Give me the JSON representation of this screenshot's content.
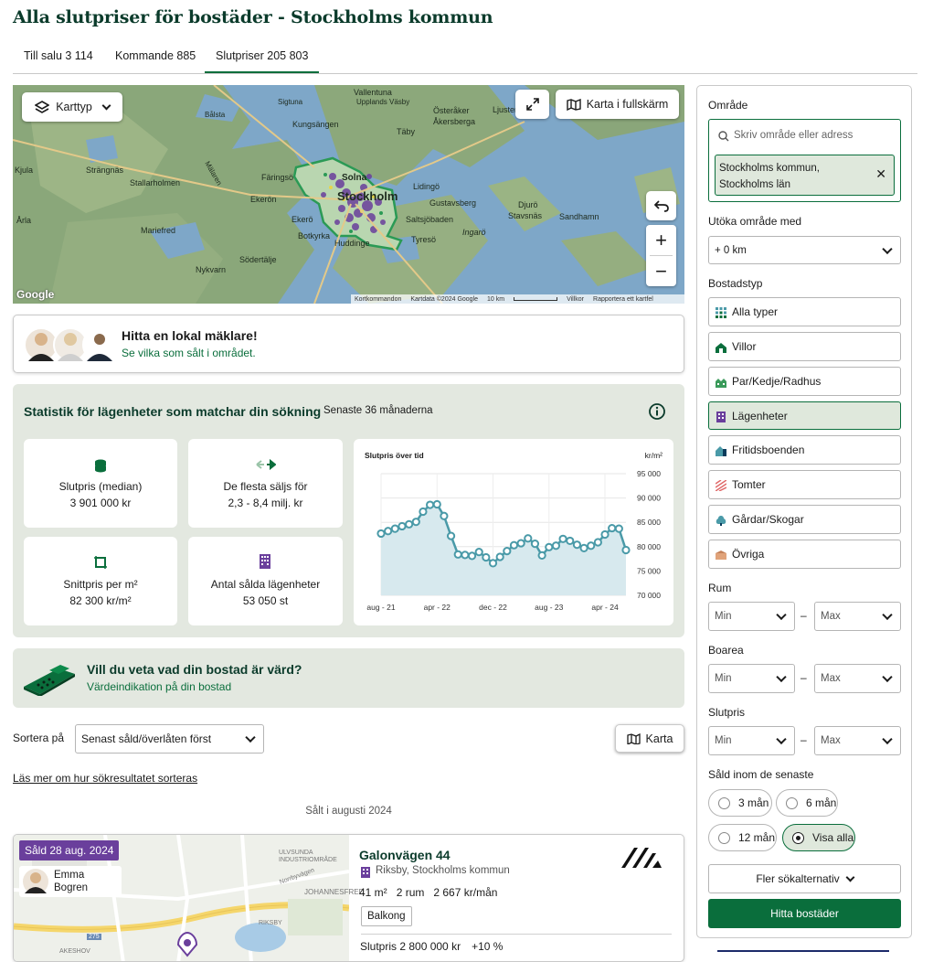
{
  "page": {
    "title": "Alla slutpriser för bostäder - Stockholms kommun"
  },
  "tabs": [
    {
      "label": "Till salu 3 114",
      "active": false
    },
    {
      "label": "Kommande 885",
      "active": false
    },
    {
      "label": "Slutpriser 205 803",
      "active": true
    }
  ],
  "map": {
    "map_type_label": "Karttyp",
    "fullscreen_label": "Karta i fullskärm",
    "places": [
      "Vallentuna",
      "Upplands Väsby",
      "Sigtuna",
      "Österåker",
      "Kungsängen",
      "Åkersberga",
      "Ljusterö",
      "Bålsta",
      "Täby",
      "Kjula",
      "Strängnäs",
      "Stallarholmen",
      "Färingsö",
      "Mälaren",
      "Solna",
      "Stockholm",
      "Lidingö",
      "Gustavsberg",
      "Djurö",
      "Stavsnäs",
      "Sandhamn",
      "Ekerön",
      "Ekerö",
      "Saltsjöbaden",
      "Ingarö",
      "Årla",
      "Mariefred",
      "Botkyrka",
      "Huddinge",
      "Tyresö",
      "Nykvarn",
      "Södertälje",
      "Google"
    ],
    "footer": [
      "Kortkommandon",
      "Kartdata ©2024 Google",
      "10 km",
      "Villkor",
      "Rapportera ett kartfel"
    ]
  },
  "agent_promo": {
    "title": "Hitta en lokal mäklare!",
    "subtitle": "Se vilka som sålt i området."
  },
  "stats": {
    "heading": "Statistik för lägenheter som matchar din sökning",
    "period": "Senaste 36 månaderna",
    "cards": [
      {
        "icon": "coins-icon",
        "label": "Slutpris (median)",
        "value": "3 901 000 kr"
      },
      {
        "icon": "arrows-icon",
        "label": "De flesta säljs för",
        "value": "2,3 - 8,4 milj. kr"
      },
      {
        "icon": "ruler-icon",
        "label": "Snittpris per m²",
        "value": "82 300 kr/m²"
      },
      {
        "icon": "building-icon",
        "label": "Antal sålda lägenheter",
        "value": "53 050 st"
      }
    ],
    "colors": {
      "line": "#4a9aa8",
      "fill": "#d7e9ee",
      "panel": "#e3e8e0"
    }
  },
  "chart_data": {
    "type": "area",
    "title": "Slutpris över tid",
    "ylabel": "kr/m²",
    "x_tick_labels": [
      "aug - 21",
      "apr - 22",
      "dec - 22",
      "aug - 23",
      "apr - 24"
    ],
    "y_tick_labels": [
      "95 000",
      "90 000",
      "85 000",
      "80 000",
      "75 000",
      "70 000"
    ],
    "ylim": [
      70000,
      95000
    ],
    "grid": true,
    "x": [
      "2021-08",
      "2021-09",
      "2021-10",
      "2021-11",
      "2021-12",
      "2022-01",
      "2022-02",
      "2022-03",
      "2022-04",
      "2022-05",
      "2022-06",
      "2022-07",
      "2022-08",
      "2022-09",
      "2022-10",
      "2022-11",
      "2022-12",
      "2023-01",
      "2023-02",
      "2023-03",
      "2023-04",
      "2023-05",
      "2023-06",
      "2023-07",
      "2023-08",
      "2023-09",
      "2023-10",
      "2023-11",
      "2023-12",
      "2024-01",
      "2024-02",
      "2024-03",
      "2024-04",
      "2024-05",
      "2024-06",
      "2024-07"
    ],
    "values": [
      82700,
      83200,
      83700,
      84200,
      84600,
      85100,
      87200,
      88600,
      88700,
      86300,
      82200,
      78400,
      78300,
      78100,
      78900,
      77800,
      76600,
      77900,
      79100,
      80300,
      80700,
      81700,
      80600,
      78200,
      79900,
      80200,
      81600,
      81200,
      80400,
      79700,
      80200,
      80900,
      82500,
      83800,
      83700,
      79300
    ]
  },
  "valuation": {
    "title": "Vill du veta vad din bostad är värd?",
    "subtitle": "Värdeindikation på din bostad"
  },
  "sort": {
    "label": "Sortera på",
    "value": "Senast såld/överlåten först",
    "map_button": "Karta",
    "info_link": "Läs mer om hur sökresultatet sorteras"
  },
  "results": {
    "group_heading": "Sålt i augusti 2024",
    "listing": {
      "sold_badge": "Såld 28 aug. 2024",
      "agent_name": "Emma Bogren",
      "address": "Galonvägen 44",
      "area": "Riksby, Stockholms kommun",
      "size": "41 m²",
      "rooms": "2 rum",
      "fee": "2 667 kr/mån",
      "tag": "Balkong",
      "price": "Slutpris 2 800 000 kr",
      "change": "+10 %",
      "map_places": [
        "ULVSUNDA INDUSTRIOMRÅDE",
        "JOHANNESFRED",
        "RIKSBY",
        "AKESHOV",
        "Norrbyvägen",
        "275"
      ]
    }
  },
  "sidebar": {
    "area_label": "Område",
    "search_placeholder": "Skriv område eller adress",
    "chip": "Stockholms kommun, Stockholms län",
    "expand_label": "Utöka område med",
    "expand_value": "+ 0 km",
    "type_label": "Bostadstyp",
    "types": [
      {
        "label": "Alla typer",
        "icon": "grid-icon",
        "selected": false
      },
      {
        "label": "Villor",
        "icon": "house-icon",
        "selected": false
      },
      {
        "label": "Par/Kedje/Radhus",
        "icon": "rowhouse-icon",
        "selected": false
      },
      {
        "label": "Lägenheter",
        "icon": "apartment-icon",
        "selected": true
      },
      {
        "label": "Fritidsboenden",
        "icon": "cottage-icon",
        "selected": false
      },
      {
        "label": "Tomter",
        "icon": "plot-icon",
        "selected": false
      },
      {
        "label": "Gårdar/Skogar",
        "icon": "tree-icon",
        "selected": false
      },
      {
        "label": "Övriga",
        "icon": "other-icon",
        "selected": false
      }
    ],
    "rooms_label": "Rum",
    "area2_label": "Boarea",
    "price_label": "Slutpris",
    "min": "Min",
    "max": "Max",
    "dash": "–",
    "sold_within_label": "Såld inom de senaste",
    "sold_within_options": [
      {
        "label": "3 mån",
        "selected": false
      },
      {
        "label": "6 mån",
        "selected": false
      },
      {
        "label": "12 mån",
        "selected": false
      },
      {
        "label": "Visa alla",
        "selected": true
      }
    ],
    "more_options": "Fler sökalternativ",
    "search_button": "Hitta bostäder"
  }
}
